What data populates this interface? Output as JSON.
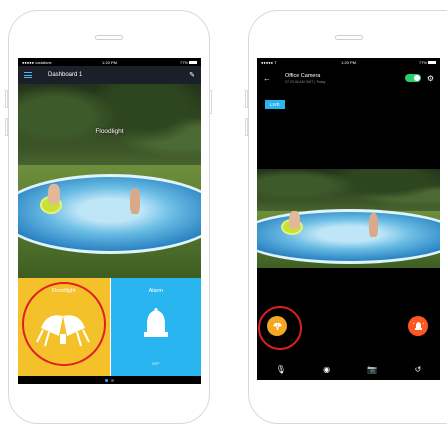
{
  "left_phone": {
    "status_bar": {
      "carrier": "●●●●● vodafone",
      "time": "1:20 PM",
      "battery": "77%"
    },
    "app_bar": {
      "title": "Dashboard 1"
    },
    "camera": {
      "label": "Floodlight"
    },
    "tiles": [
      {
        "label": "Floodlight",
        "icon": "floodlight-icon",
        "color": "#f5c12a"
      },
      {
        "label": "Alarm",
        "icon": "siren-icon",
        "sublabel": "OFF",
        "color": "#29b6f0"
      }
    ],
    "pager": {
      "count": 2,
      "active": 0
    }
  },
  "right_phone": {
    "status_bar": {
      "carrier": "●●●●● T",
      "time": "1:20 PM",
      "battery": "77%"
    },
    "header": {
      "title": "Office Camera",
      "subtitle": "07:23:45 AM GMT | Today",
      "toggle_on": true
    },
    "live_badge": "LIVE",
    "controls": {
      "floodlight_button_color": "#f5a623",
      "alarm_button_color": "#ff5722",
      "bottom_icons": [
        "microphone-icon",
        "record-icon",
        "camera-icon",
        "history-icon"
      ]
    }
  },
  "annotation_color": "#e02020"
}
